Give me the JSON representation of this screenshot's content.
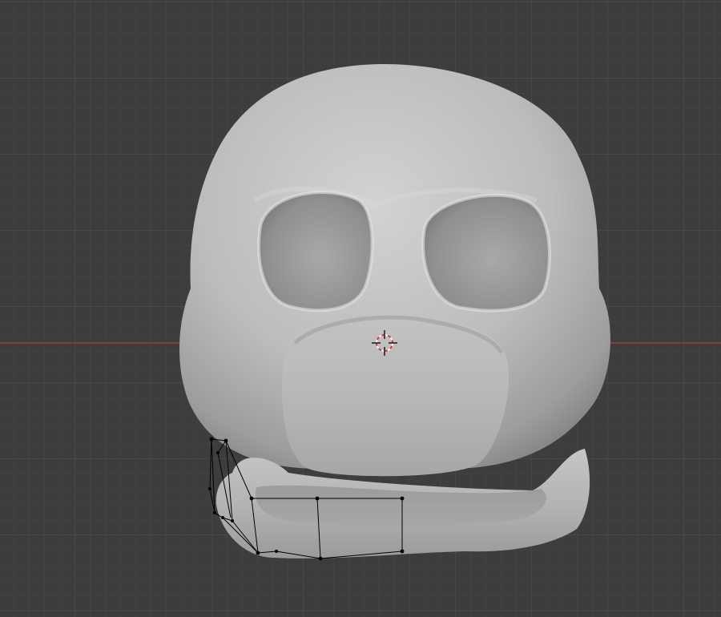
{
  "viewport": {
    "view": "3D Viewport",
    "shading": "solid",
    "grid": true
  },
  "colors": {
    "background": "#3d3d3d",
    "grid_minor": "#464646",
    "grid_major": "#4b4b4b",
    "x_axis": "#9c3b44",
    "mesh_light": "#c9c9c9",
    "mesh_shadow": "#6e6e6e",
    "wireframe": "#000000",
    "cursor_red": "#d33a3a",
    "cursor_white": "#f2f2f2"
  },
  "scene": {
    "objects": [
      {
        "name": "head-mesh",
        "type": "mesh"
      },
      {
        "name": "jaw-mesh",
        "type": "mesh",
        "mode": "edit",
        "selected": true
      }
    ],
    "cursor": "3d-cursor-icon"
  }
}
